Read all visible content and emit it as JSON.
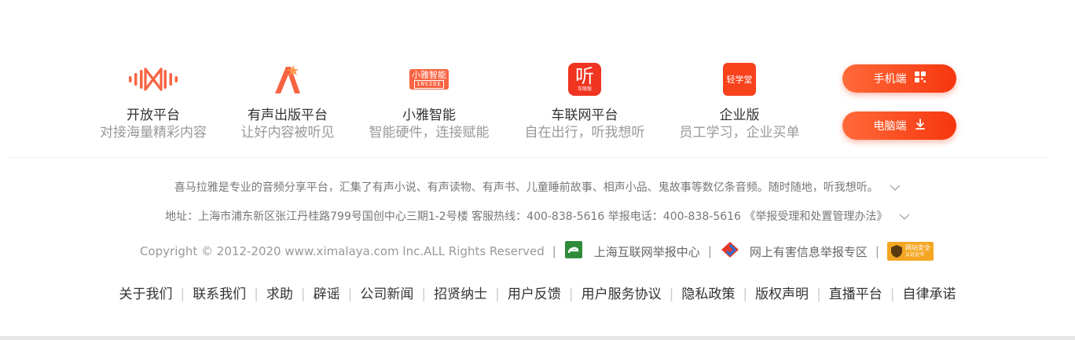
{
  "products": [
    {
      "name": "开放平台",
      "sub": "对接海量精彩内容",
      "icon": "sound-wave-icon"
    },
    {
      "name": "有声出版平台",
      "sub": "让好内容被听见",
      "icon": "star-a-icon"
    },
    {
      "name": "小雅智能",
      "sub": "智能硬件，连接赋能",
      "icon": "xiaoya-inside-icon",
      "icon_text": "小雅智能",
      "icon_subtext": "INSIDE"
    },
    {
      "name": "车联网平台",
      "sub": "自在出行，听我想听",
      "icon": "car-ting-icon",
      "icon_text": "听",
      "icon_subtext": "车联版"
    },
    {
      "name": "企业版",
      "sub": "员工学习，企业买单",
      "icon": "qingxuetang-icon",
      "icon_text": "轻学堂"
    }
  ],
  "buttons": {
    "mobile": "手机端",
    "pc": "电脑端"
  },
  "info": {
    "line1": "喜马拉雅是专业的音频分享平台，汇集了有声小说、有声读物、有声书、儿童睡前故事、相声小品、鬼故事等数亿条音频。随时随地，听我想听。",
    "line2": "地址：上海市浦东新区张江丹桂路799号国创中心三期1-2号楼  客服热线：400-838-5616  举报电话：400-838-5616  《举报受理和处置管理办法》"
  },
  "copyright": "Copyright © 2012-2020 www.ximalaya.com lnc.ALL Rights Reserved",
  "report_links": [
    {
      "label": "上海互联网举报中心",
      "icon": "shanghai-report-icon"
    },
    {
      "label": "网上有害信息举报专区",
      "icon": "harmful-info-report-icon"
    }
  ],
  "security_badge": {
    "line1": "网站安全",
    "line2": "认证证书"
  },
  "footer_links": [
    "关于我们",
    "联系我们",
    "求助",
    "辟谣",
    "公司新闻",
    "招贤纳士",
    "用户反馈",
    "用户服务协议",
    "隐私政策",
    "版权声明",
    "直播平台",
    "自律承诺"
  ],
  "colors": {
    "brand": "#f86442",
    "accent": "#f6360e"
  }
}
